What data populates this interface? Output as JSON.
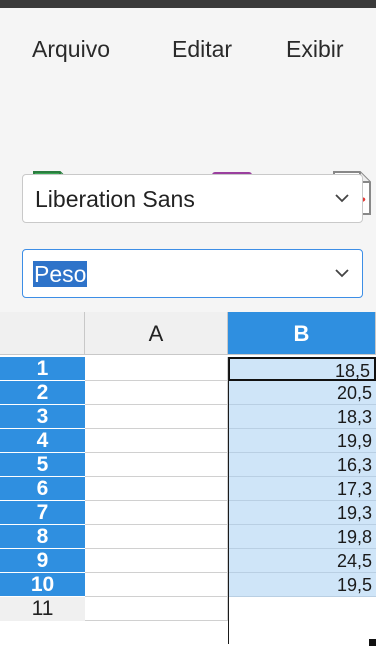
{
  "menubar": {
    "items": [
      {
        "label": "Arquivo"
      },
      {
        "label": "Editar"
      },
      {
        "label": "Exibir"
      }
    ]
  },
  "toolbar": {
    "icons": [
      "new-spreadsheet-icon",
      "open-folder-icon",
      "save-icon",
      "export-pdf-icon"
    ]
  },
  "font_name": {
    "value": "Liberation Sans"
  },
  "name_box": {
    "value": "Peso"
  },
  "sheet": {
    "columns": [
      "A",
      "B"
    ],
    "rows": [
      {
        "num": "1",
        "a": "",
        "b": "18,5"
      },
      {
        "num": "2",
        "a": "",
        "b": "20,5"
      },
      {
        "num": "3",
        "a": "",
        "b": "18,3"
      },
      {
        "num": "4",
        "a": "",
        "b": "19,9"
      },
      {
        "num": "5",
        "a": "",
        "b": "16,3"
      },
      {
        "num": "6",
        "a": "",
        "b": "17,3"
      },
      {
        "num": "7",
        "a": "",
        "b": "19,3"
      },
      {
        "num": "8",
        "a": "",
        "b": "19,8"
      },
      {
        "num": "9",
        "a": "",
        "b": "24,5"
      },
      {
        "num": "10",
        "a": "",
        "b": "19,5"
      },
      {
        "num": "11",
        "a": "",
        "b": ""
      }
    ]
  },
  "colors": {
    "selection_header": "#2f8fe0",
    "selection_fill": "#cfe5f8",
    "namebox_border": "#3d8ee6"
  }
}
